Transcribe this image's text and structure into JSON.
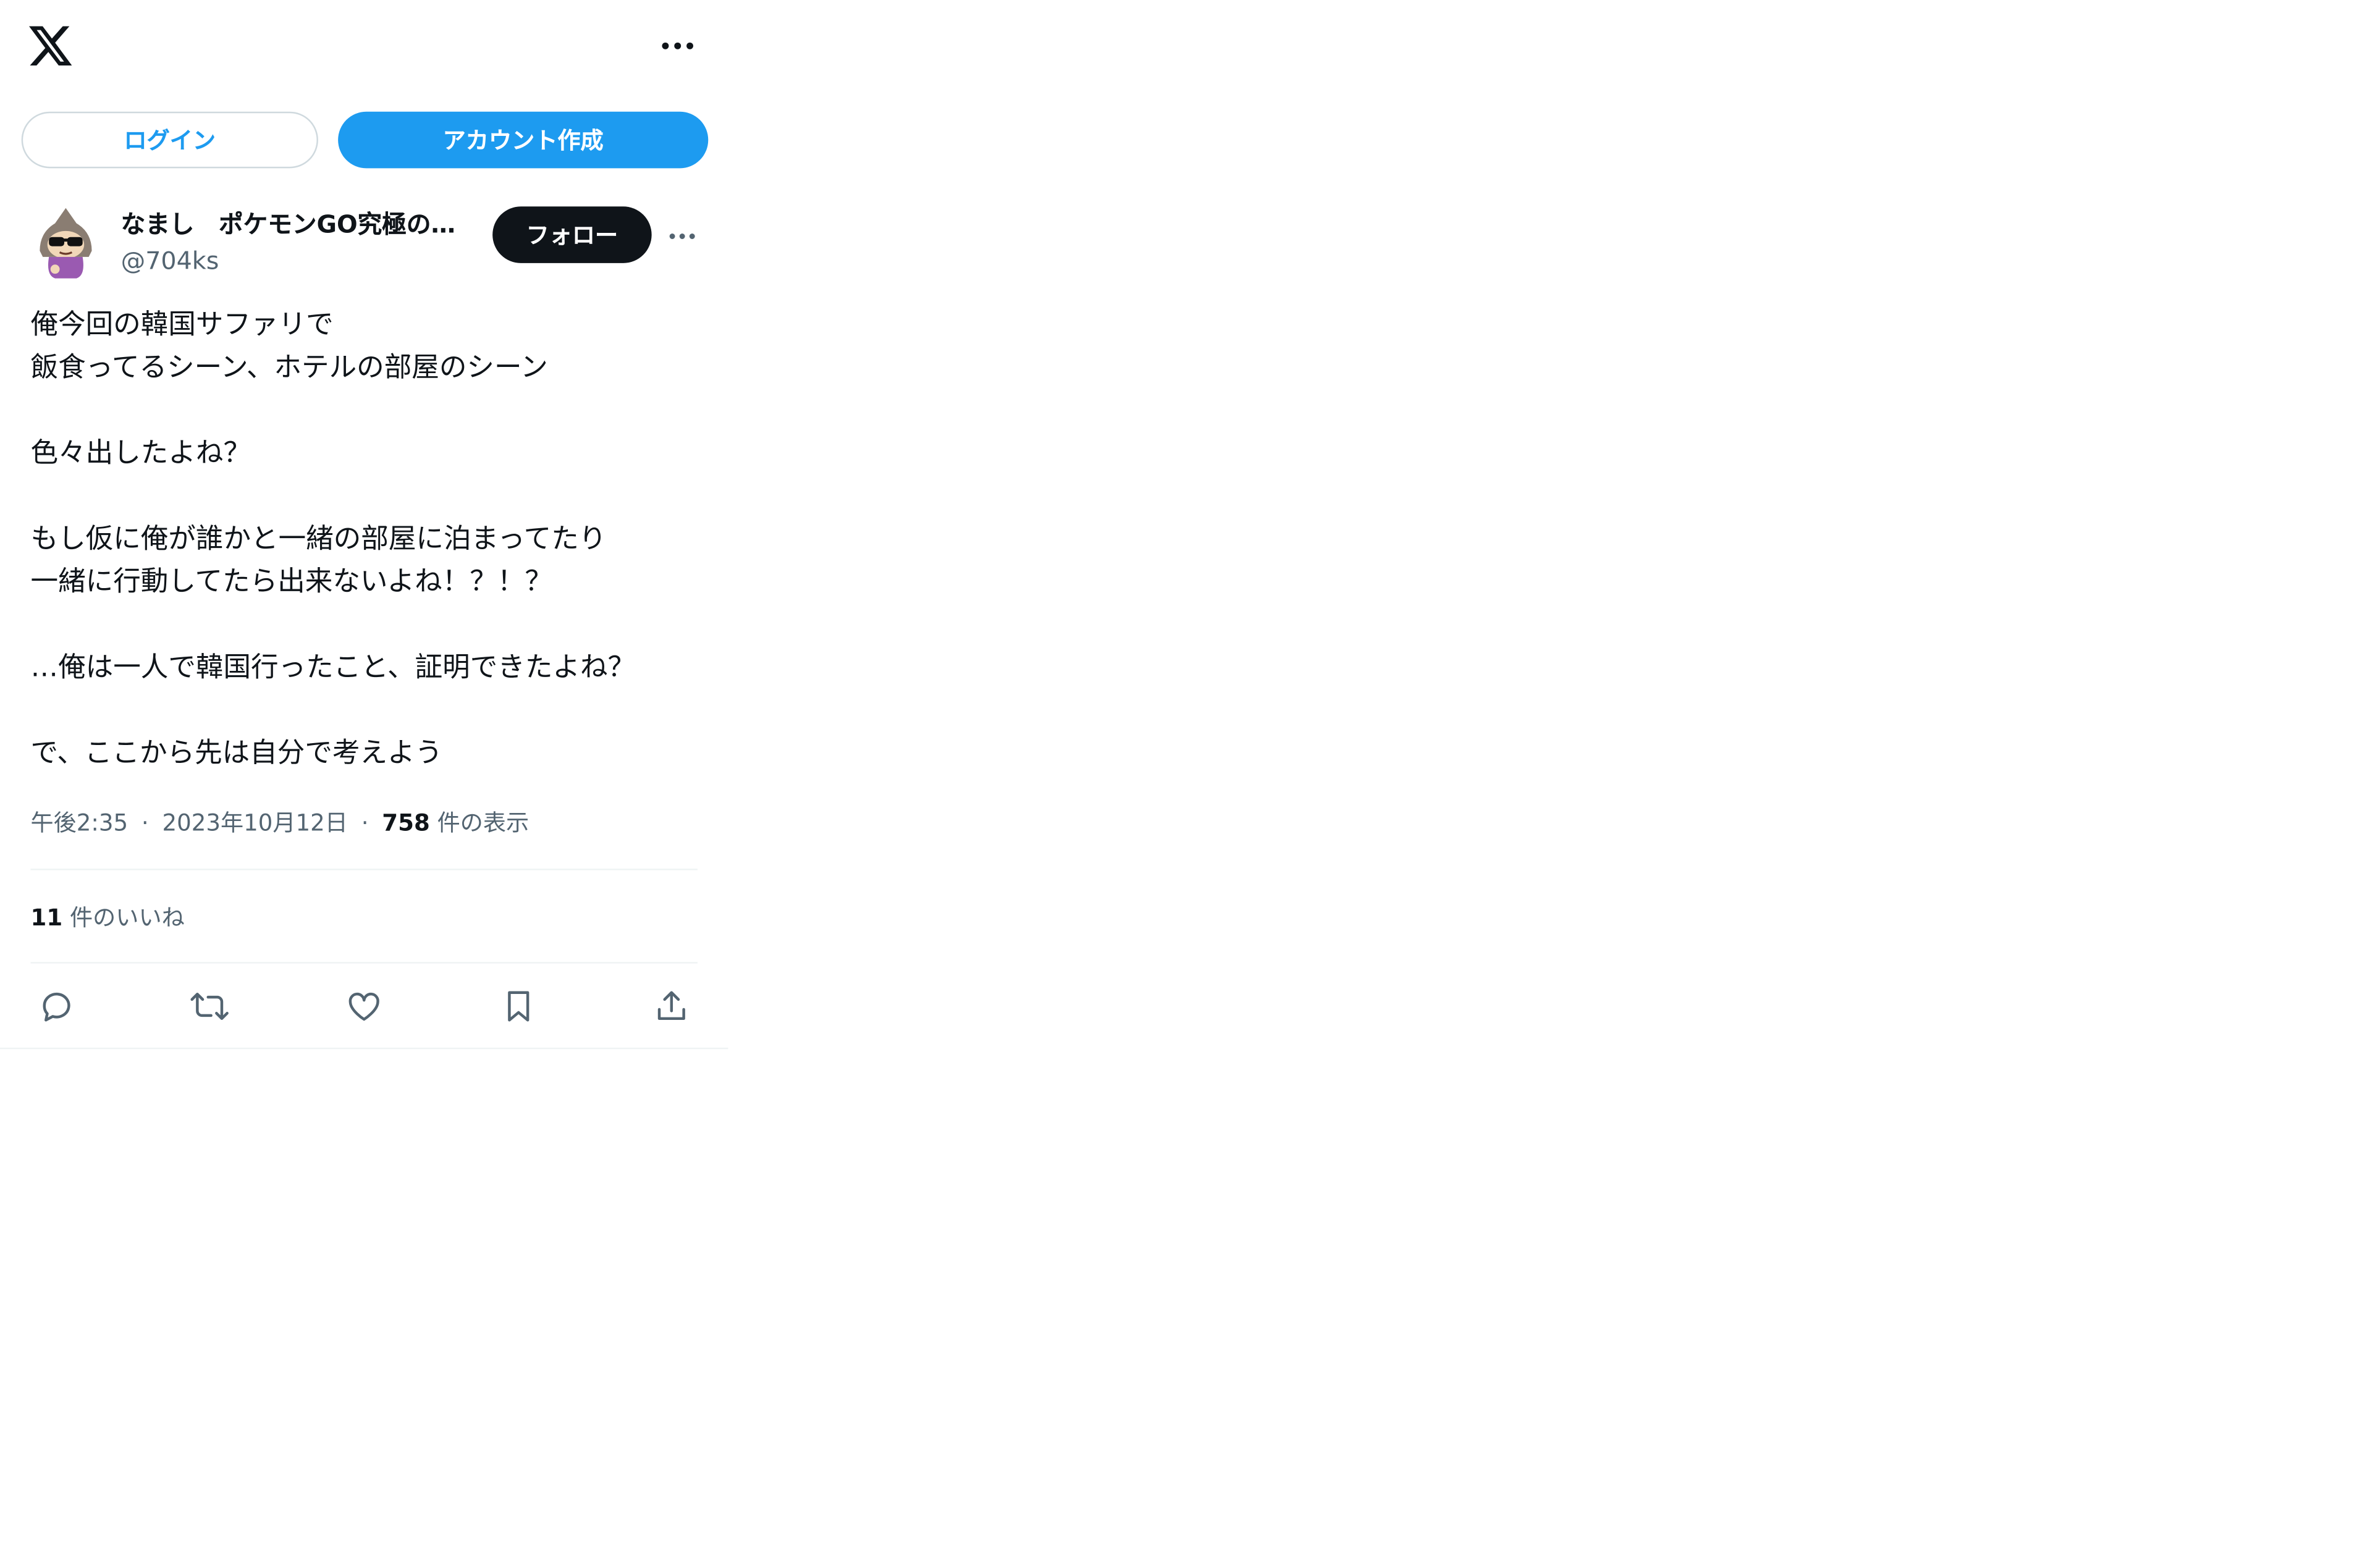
{
  "header": {
    "logo_icon": "x-logo-icon",
    "more_icon": "more-horizontal-icon"
  },
  "auth": {
    "login_label": "ログイン",
    "signup_label": "アカウント作成"
  },
  "tweet": {
    "author": {
      "display_name": "なまし　ポケモンGO究極の…",
      "handle": "@704ks"
    },
    "follow_label": "フォロー",
    "text_lines": [
      "俺今回の韓国サファリで",
      "飯食ってるシーン、ホテルの部屋のシーン",
      "",
      "色々出したよね？",
      "",
      "もし仮に俺が誰かと一緒の部屋に泊まってたり",
      "一緒に行動してたら出来ないよね！？！？",
      "",
      "…俺は一人で韓国行ったこと、証明できたよね？",
      "",
      "で、ここから先は自分で考えよう"
    ],
    "time": "午後2:35",
    "separator": "·",
    "date": "2023年10月12日",
    "views_count": "758",
    "views_label": "件の表示",
    "likes_count": "11",
    "likes_label": "件のいいね"
  },
  "actions": [
    {
      "name": "reply-icon"
    },
    {
      "name": "retweet-icon"
    },
    {
      "name": "like-icon"
    },
    {
      "name": "bookmark-icon"
    },
    {
      "name": "share-icon"
    }
  ],
  "colors": {
    "accent": "#1d9bf0",
    "text": "#0f1419",
    "secondary_text": "#536471",
    "border": "#cfd9de",
    "divider": "#eff3f4"
  }
}
